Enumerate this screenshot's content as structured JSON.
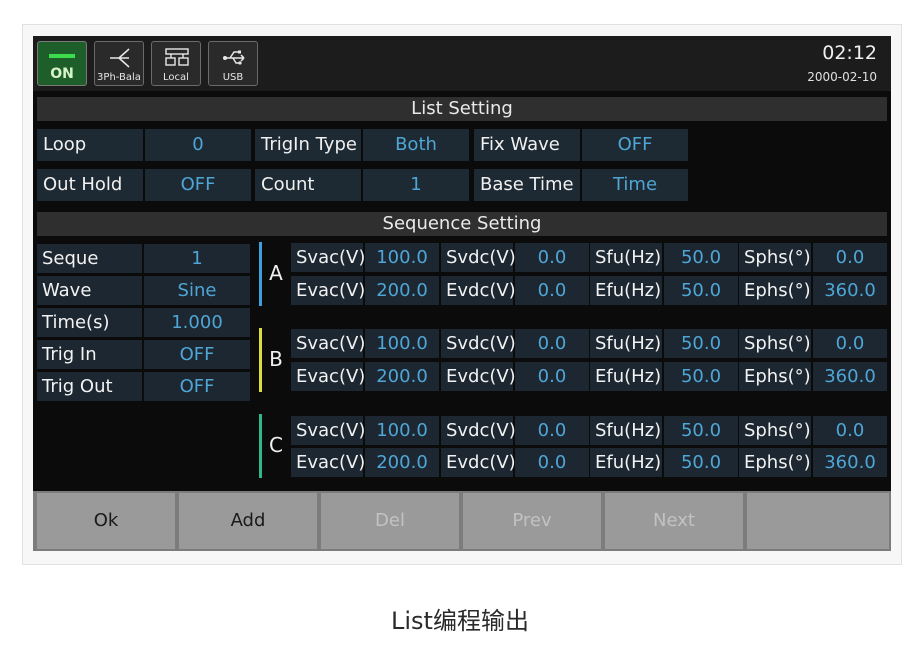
{
  "status": {
    "power_label": "ON",
    "icons": [
      {
        "name": "wiring-icon",
        "label": "3Ph-Bala"
      },
      {
        "name": "local-control-icon",
        "label": "Local"
      },
      {
        "name": "usb-icon",
        "label": "USB"
      }
    ],
    "time": "02:12",
    "date": "2000-02-10",
    "power_color": "#3cdc4a"
  },
  "list_setting": {
    "title": "List Setting",
    "row1": [
      {
        "label": "Loop",
        "value": "0"
      },
      {
        "label": "TrigIn Type",
        "value": "Both"
      },
      {
        "label": "Fix Wave",
        "value": "OFF"
      }
    ],
    "row2": [
      {
        "label": "Out Hold",
        "value": "OFF"
      },
      {
        "label": "Count",
        "value": "1"
      },
      {
        "label": "Base Time",
        "value": "Time"
      }
    ]
  },
  "sequence_setting": {
    "title": "Sequence Setting",
    "params": [
      {
        "label": "Seque",
        "value": "1"
      },
      {
        "label": "Wave",
        "value": "Sine"
      },
      {
        "label": "Time(s)",
        "value": "1.000"
      },
      {
        "label": "Trig In",
        "value": "OFF"
      },
      {
        "label": "Trig Out",
        "value": "OFF"
      }
    ],
    "phases": [
      {
        "name": "A",
        "color": "#3d9fdc",
        "row1": [
          {
            "label": "Svac(V)",
            "value": "100.0"
          },
          {
            "label": "Svdc(V)",
            "value": "0.0"
          },
          {
            "label": "Sfu(Hz)",
            "value": "50.0"
          },
          {
            "label": "Sphs(°)",
            "value": "0.0"
          }
        ],
        "row2": [
          {
            "label": "Evac(V)",
            "value": "200.0"
          },
          {
            "label": "Evdc(V)",
            "value": "0.0"
          },
          {
            "label": "Efu(Hz)",
            "value": "50.0"
          },
          {
            "label": "Ephs(°)",
            "value": "360.0"
          }
        ]
      },
      {
        "name": "B",
        "color": "#d9dc3c",
        "row1": [
          {
            "label": "Svac(V)",
            "value": "100.0"
          },
          {
            "label": "Svdc(V)",
            "value": "0.0"
          },
          {
            "label": "Sfu(Hz)",
            "value": "50.0"
          },
          {
            "label": "Sphs(°)",
            "value": "0.0"
          }
        ],
        "row2": [
          {
            "label": "Evac(V)",
            "value": "200.0"
          },
          {
            "label": "Evdc(V)",
            "value": "0.0"
          },
          {
            "label": "Efu(Hz)",
            "value": "50.0"
          },
          {
            "label": "Ephs(°)",
            "value": "360.0"
          }
        ]
      },
      {
        "name": "C",
        "color": "#2fb98a",
        "row1": [
          {
            "label": "Svac(V)",
            "value": "100.0"
          },
          {
            "label": "Svdc(V)",
            "value": "0.0"
          },
          {
            "label": "Sfu(Hz)",
            "value": "50.0"
          },
          {
            "label": "Sphs(°)",
            "value": "0.0"
          }
        ],
        "row2": [
          {
            "label": "Evac(V)",
            "value": "200.0"
          },
          {
            "label": "Evdc(V)",
            "value": "0.0"
          },
          {
            "label": "Efu(Hz)",
            "value": "50.0"
          },
          {
            "label": "Ephs(°)",
            "value": "360.0"
          }
        ]
      }
    ]
  },
  "buttons": [
    {
      "label": "Ok",
      "enabled": true
    },
    {
      "label": "Add",
      "enabled": true
    },
    {
      "label": "Del",
      "enabled": false
    },
    {
      "label": "Prev",
      "enabled": false
    },
    {
      "label": "Next",
      "enabled": false
    },
    {
      "label": "",
      "enabled": false
    }
  ],
  "caption": "List编程输出"
}
